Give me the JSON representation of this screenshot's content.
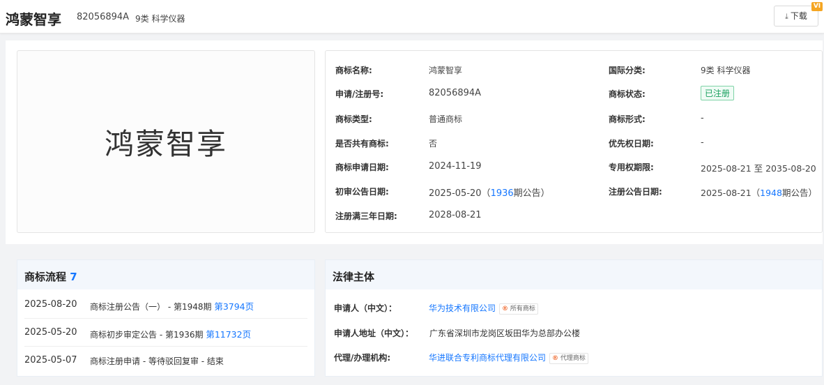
{
  "header": {
    "title": "鸿蒙智享",
    "reg_no": "82056894A",
    "class": "9类 科学仪器",
    "download_label": "下载",
    "vip": "VI"
  },
  "logo": {
    "text": "鸿蒙智享"
  },
  "info": {
    "rows": [
      {
        "label": "商标名称:",
        "value": "鸿蒙智享"
      },
      {
        "label": "申请/注册号:",
        "value": "82056894A"
      },
      {
        "label": "商标类型:",
        "value": "普通商标"
      },
      {
        "label": "是否共有商标:",
        "value": "否"
      },
      {
        "label": "商标申请日期:",
        "value": "2024-11-19"
      },
      {
        "label": "初审公告日期:",
        "value_pre": "2025-05-20（",
        "value_link": "1936",
        "value_post": "期公告）"
      },
      {
        "label": "注册满三年日期:",
        "value": "2028-08-21"
      }
    ],
    "rows_right": [
      {
        "label": "国际分类:",
        "value": "9类 科学仪器"
      },
      {
        "label": "商标状态:",
        "value": "已注册"
      },
      {
        "label": "商标形式:",
        "value": "-"
      },
      {
        "label": "优先权日期:",
        "value": "-"
      },
      {
        "label": "专用权期限:",
        "value": "2025-08-21 至 2035-08-20"
      },
      {
        "label": "注册公告日期:",
        "value_pre": "2025-08-21（",
        "value_link": "1948",
        "value_post": "期公告）"
      }
    ]
  },
  "flow": {
    "title": "商标流程",
    "count": "7",
    "items": [
      {
        "date": "2025-08-20",
        "desc": "商标注册公告（一） - 第1948期 ",
        "link": "第3794页"
      },
      {
        "date": "2025-05-20",
        "desc": "商标初步审定公告 - 第1936期 ",
        "link": "第11732页"
      },
      {
        "date": "2025-05-07",
        "desc": "商标注册申请 - 等待驳回复审 - 结束",
        "link": ""
      }
    ]
  },
  "legal": {
    "title": "法律主体",
    "rows": [
      {
        "label": "申请人（中文）：",
        "value": "华为技术有限公司",
        "tag": "所有商标"
      },
      {
        "label": "申请人地址（中文）：",
        "value": "广东省深圳市龙岗区坂田华为总部办公楼",
        "tag": ""
      },
      {
        "label": "代理/办理机构:",
        "value": "华进联合专利商标代理有限公司",
        "tag": "代理商标"
      }
    ]
  },
  "colors": {
    "link": "#1677ff",
    "status_green": "#19a05f",
    "head_bg": "#f3f7fc"
  }
}
